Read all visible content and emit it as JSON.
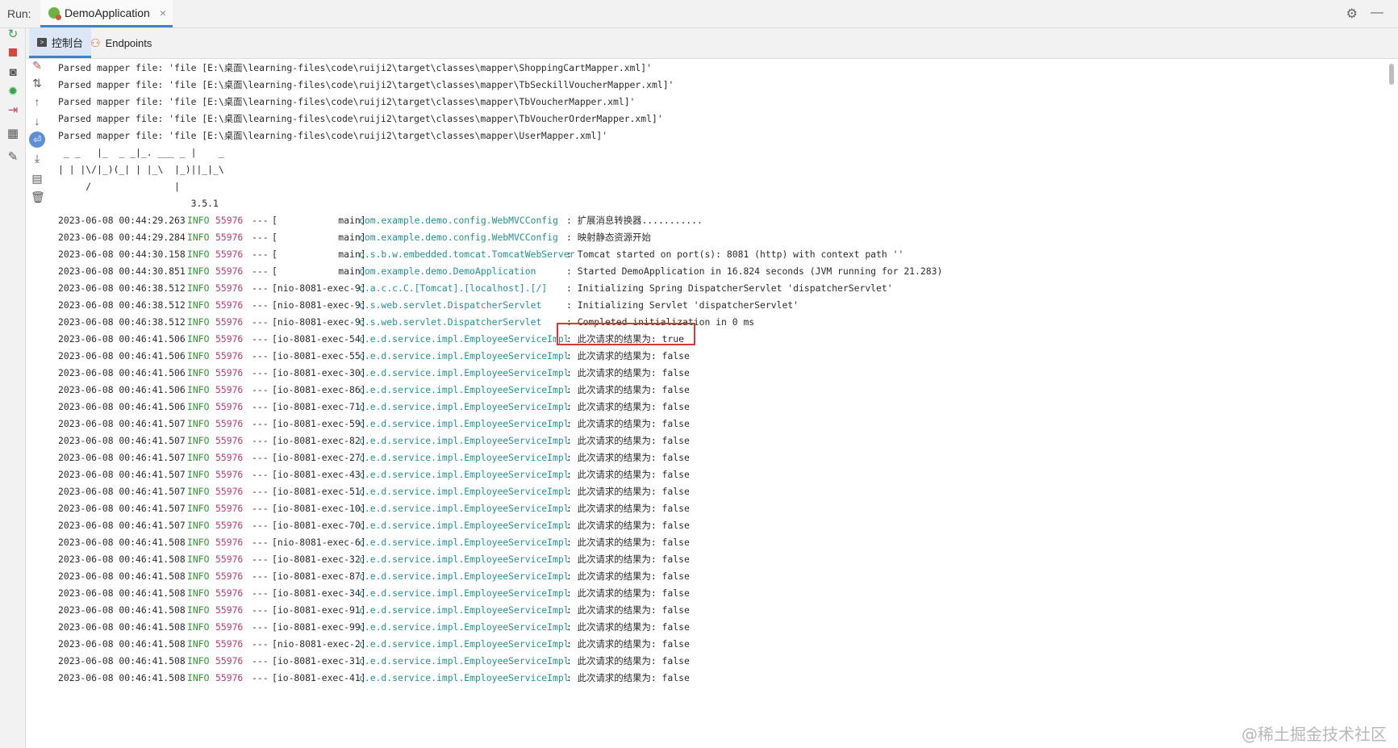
{
  "run_bar": {
    "label": "Run:",
    "tab_title": "DemoApplication",
    "close_glyph": "×",
    "settings_glyph": "⚙",
    "minimize_glyph": "—"
  },
  "subtabs": {
    "console_label": "控制台",
    "endpoints_label": "Endpoints"
  },
  "left_toolbar_icons": [
    "rerun-icon",
    "stop-icon",
    "camera-icon",
    "debug-icon",
    "exit-icon",
    "layout-icon",
    "pin-icon"
  ],
  "console_action_icons": [
    "clear-icon",
    "sort-icon",
    "up-arrow-icon",
    "down-arrow-icon",
    "soft-wrap-icon",
    "scroll-to-end-icon",
    "print-icon",
    "trash-icon"
  ],
  "console": {
    "plain_lines": [
      "Parsed mapper file: 'file [E:\\桌面\\learning-files\\code\\ruiji2\\target\\classes\\mapper\\ShoppingCartMapper.xml]'",
      "Parsed mapper file: 'file [E:\\桌面\\learning-files\\code\\ruiji2\\target\\classes\\mapper\\TbSeckillVoucherMapper.xml]'",
      "Parsed mapper file: 'file [E:\\桌面\\learning-files\\code\\ruiji2\\target\\classes\\mapper\\TbVoucherMapper.xml]'",
      "Parsed mapper file: 'file [E:\\桌面\\learning-files\\code\\ruiji2\\target\\classes\\mapper\\TbVoucherOrderMapper.xml]'",
      "Parsed mapper file: 'file [E:\\桌面\\learning-files\\code\\ruiji2\\target\\classes\\mapper\\UserMapper.xml]'",
      " _ _   |_  _ _|_. ___ _ |    _",
      "| | |\\/|_)(_| | |_\\  |_)||_|_\\",
      "     /               |",
      "                        3.5.1"
    ],
    "log_rows": [
      {
        "ts": "2023-06-08 00:44:29.263",
        "level": "INFO",
        "pid": "55976",
        "sep": "---",
        "thread": "[           main]",
        "logger": "com.example.demo.config.WebMVCConfig",
        "msg": ": 扩展消息转换器..........."
      },
      {
        "ts": "2023-06-08 00:44:29.284",
        "level": "INFO",
        "pid": "55976",
        "sep": "---",
        "thread": "[           main]",
        "logger": "com.example.demo.config.WebMVCConfig",
        "msg": ": 映射静态资源开始"
      },
      {
        "ts": "2023-06-08 00:44:30.158",
        "level": "INFO",
        "pid": "55976",
        "sep": "---",
        "thread": "[           main]",
        "logger": "o.s.b.w.embedded.tomcat.TomcatWebServer",
        "msg": ": Tomcat started on port(s): 8081 (http) with context path ''"
      },
      {
        "ts": "2023-06-08 00:44:30.851",
        "level": "INFO",
        "pid": "55976",
        "sep": "---",
        "thread": "[           main]",
        "logger": "com.example.demo.DemoApplication",
        "msg": ": Started DemoApplication in 16.824 seconds (JVM running for 21.283)"
      },
      {
        "ts": "2023-06-08 00:46:38.512",
        "level": "INFO",
        "pid": "55976",
        "sep": "---",
        "thread": "[nio-8081-exec-9]",
        "logger": "o.a.c.c.C.[Tomcat].[localhost].[/]",
        "msg": ": Initializing Spring DispatcherServlet 'dispatcherServlet'"
      },
      {
        "ts": "2023-06-08 00:46:38.512",
        "level": "INFO",
        "pid": "55976",
        "sep": "---",
        "thread": "[nio-8081-exec-9]",
        "logger": "o.s.web.servlet.DispatcherServlet",
        "msg": ": Initializing Servlet 'dispatcherServlet'"
      },
      {
        "ts": "2023-06-08 00:46:38.512",
        "level": "INFO",
        "pid": "55976",
        "sep": "---",
        "thread": "[nio-8081-exec-9]",
        "logger": "o.s.web.servlet.DispatcherServlet",
        "msg": ": Completed initialization in 0 ms"
      },
      {
        "ts": "2023-06-08 00:46:41.506",
        "level": "INFO",
        "pid": "55976",
        "sep": "---",
        "thread": "[io-8081-exec-54]",
        "logger": "c.e.d.service.impl.EmployeeServiceImpl",
        "msg": ": 此次请求的结果为: true"
      },
      {
        "ts": "2023-06-08 00:46:41.506",
        "level": "INFO",
        "pid": "55976",
        "sep": "---",
        "thread": "[io-8081-exec-55]",
        "logger": "c.e.d.service.impl.EmployeeServiceImpl",
        "msg": ": 此次请求的结果为: false"
      },
      {
        "ts": "2023-06-08 00:46:41.506",
        "level": "INFO",
        "pid": "55976",
        "sep": "---",
        "thread": "[io-8081-exec-30]",
        "logger": "c.e.d.service.impl.EmployeeServiceImpl",
        "msg": ": 此次请求的结果为: false"
      },
      {
        "ts": "2023-06-08 00:46:41.506",
        "level": "INFO",
        "pid": "55976",
        "sep": "---",
        "thread": "[io-8081-exec-86]",
        "logger": "c.e.d.service.impl.EmployeeServiceImpl",
        "msg": ": 此次请求的结果为: false"
      },
      {
        "ts": "2023-06-08 00:46:41.506",
        "level": "INFO",
        "pid": "55976",
        "sep": "---",
        "thread": "[io-8081-exec-71]",
        "logger": "c.e.d.service.impl.EmployeeServiceImpl",
        "msg": ": 此次请求的结果为: false"
      },
      {
        "ts": "2023-06-08 00:46:41.507",
        "level": "INFO",
        "pid": "55976",
        "sep": "---",
        "thread": "[io-8081-exec-59]",
        "logger": "c.e.d.service.impl.EmployeeServiceImpl",
        "msg": ": 此次请求的结果为: false"
      },
      {
        "ts": "2023-06-08 00:46:41.507",
        "level": "INFO",
        "pid": "55976",
        "sep": "---",
        "thread": "[io-8081-exec-82]",
        "logger": "c.e.d.service.impl.EmployeeServiceImpl",
        "msg": ": 此次请求的结果为: false"
      },
      {
        "ts": "2023-06-08 00:46:41.507",
        "level": "INFO",
        "pid": "55976",
        "sep": "---",
        "thread": "[io-8081-exec-27]",
        "logger": "c.e.d.service.impl.EmployeeServiceImpl",
        "msg": ": 此次请求的结果为: false"
      },
      {
        "ts": "2023-06-08 00:46:41.507",
        "level": "INFO",
        "pid": "55976",
        "sep": "---",
        "thread": "[io-8081-exec-43]",
        "logger": "c.e.d.service.impl.EmployeeServiceImpl",
        "msg": ": 此次请求的结果为: false"
      },
      {
        "ts": "2023-06-08 00:46:41.507",
        "level": "INFO",
        "pid": "55976",
        "sep": "---",
        "thread": "[io-8081-exec-51]",
        "logger": "c.e.d.service.impl.EmployeeServiceImpl",
        "msg": ": 此次请求的结果为: false"
      },
      {
        "ts": "2023-06-08 00:46:41.507",
        "level": "INFO",
        "pid": "55976",
        "sep": "---",
        "thread": "[io-8081-exec-10]",
        "logger": "c.e.d.service.impl.EmployeeServiceImpl",
        "msg": ": 此次请求的结果为: false"
      },
      {
        "ts": "2023-06-08 00:46:41.507",
        "level": "INFO",
        "pid": "55976",
        "sep": "---",
        "thread": "[io-8081-exec-70]",
        "logger": "c.e.d.service.impl.EmployeeServiceImpl",
        "msg": ": 此次请求的结果为: false"
      },
      {
        "ts": "2023-06-08 00:46:41.508",
        "level": "INFO",
        "pid": "55976",
        "sep": "---",
        "thread": "[nio-8081-exec-6]",
        "logger": "c.e.d.service.impl.EmployeeServiceImpl",
        "msg": ": 此次请求的结果为: false"
      },
      {
        "ts": "2023-06-08 00:46:41.508",
        "level": "INFO",
        "pid": "55976",
        "sep": "---",
        "thread": "[io-8081-exec-32]",
        "logger": "c.e.d.service.impl.EmployeeServiceImpl",
        "msg": ": 此次请求的结果为: false"
      },
      {
        "ts": "2023-06-08 00:46:41.508",
        "level": "INFO",
        "pid": "55976",
        "sep": "---",
        "thread": "[io-8081-exec-87]",
        "logger": "c.e.d.service.impl.EmployeeServiceImpl",
        "msg": ": 此次请求的结果为: false"
      },
      {
        "ts": "2023-06-08 00:46:41.508",
        "level": "INFO",
        "pid": "55976",
        "sep": "---",
        "thread": "[io-8081-exec-34]",
        "logger": "c.e.d.service.impl.EmployeeServiceImpl",
        "msg": ": 此次请求的结果为: false"
      },
      {
        "ts": "2023-06-08 00:46:41.508",
        "level": "INFO",
        "pid": "55976",
        "sep": "---",
        "thread": "[io-8081-exec-91]",
        "logger": "c.e.d.service.impl.EmployeeServiceImpl",
        "msg": ": 此次请求的结果为: false"
      },
      {
        "ts": "2023-06-08 00:46:41.508",
        "level": "INFO",
        "pid": "55976",
        "sep": "---",
        "thread": "[io-8081-exec-99]",
        "logger": "c.e.d.service.impl.EmployeeServiceImpl",
        "msg": ": 此次请求的结果为: false"
      },
      {
        "ts": "2023-06-08 00:46:41.508",
        "level": "INFO",
        "pid": "55976",
        "sep": "---",
        "thread": "[nio-8081-exec-2]",
        "logger": "c.e.d.service.impl.EmployeeServiceImpl",
        "msg": ": 此次请求的结果为: false"
      },
      {
        "ts": "2023-06-08 00:46:41.508",
        "level": "INFO",
        "pid": "55976",
        "sep": "---",
        "thread": "[io-8081-exec-31]",
        "logger": "c.e.d.service.impl.EmployeeServiceImpl",
        "msg": ": 此次请求的结果为: false"
      },
      {
        "ts": "2023-06-08 00:46:41.508",
        "level": "INFO",
        "pid": "55976",
        "sep": "---",
        "thread": "[io-8081-exec-41]",
        "logger": "c.e.d.service.impl.EmployeeServiceImpl",
        "msg": ": 此次请求的结果为: false"
      }
    ]
  },
  "watermark": "@稀土掘金技术社区",
  "colors": {
    "info": "#2e9b2e",
    "pid": "#c0396b",
    "logger": "#22938f",
    "highlight_box": "#d83535",
    "tab_accent": "#4083c9"
  }
}
